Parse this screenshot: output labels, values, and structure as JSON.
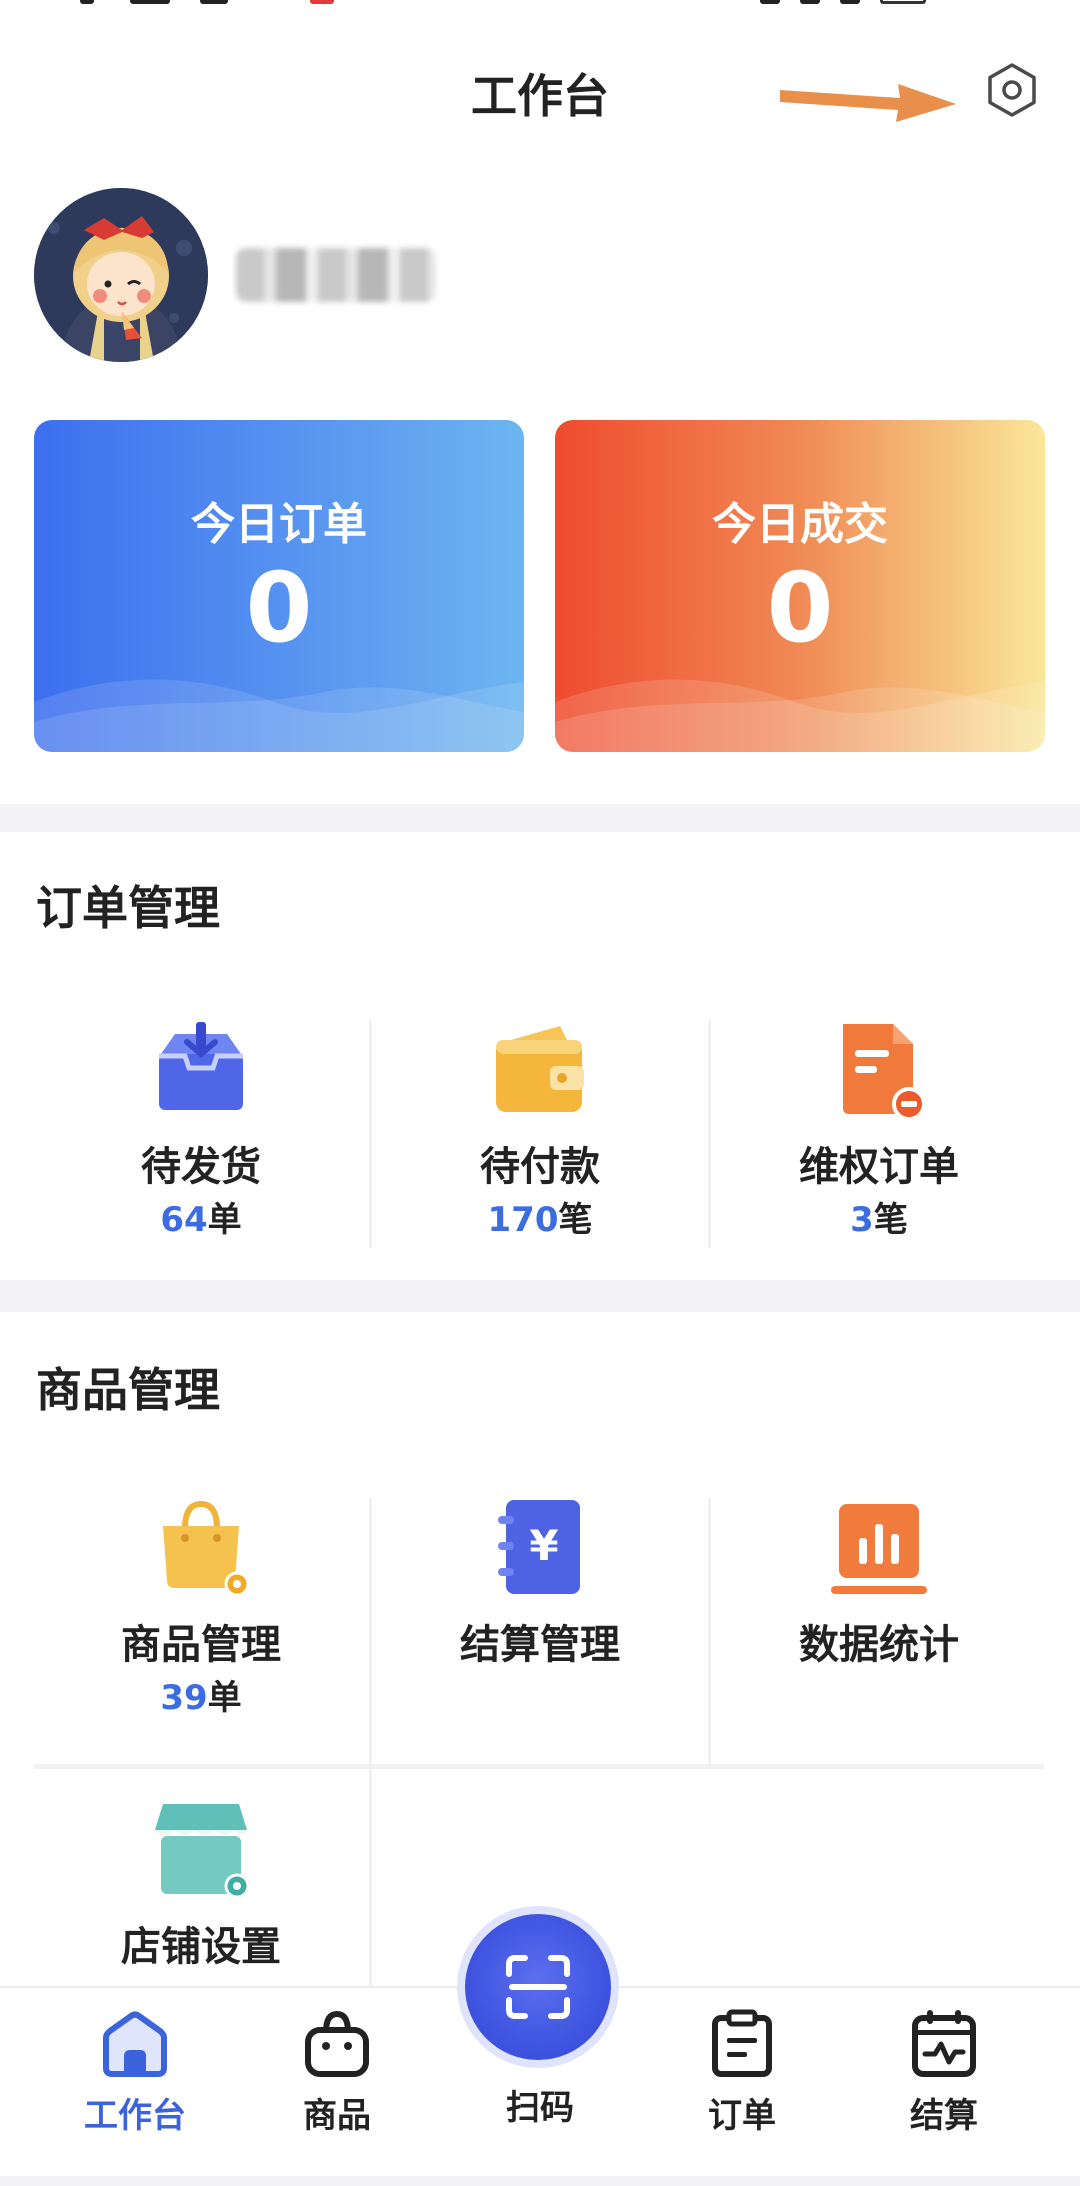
{
  "header": {
    "title": "工作台"
  },
  "profile": {
    "username": ""
  },
  "stats": [
    {
      "label": "今日订单",
      "value": "0"
    },
    {
      "label": "今日成交",
      "value": "0"
    }
  ],
  "orders": {
    "title": "订单管理",
    "items": [
      {
        "name": "待发货",
        "num": "64",
        "unit": "单",
        "icon": "inbox-icon"
      },
      {
        "name": "待付款",
        "num": "170",
        "unit": "笔",
        "icon": "wallet-icon"
      },
      {
        "name": "维权订单",
        "num": "3",
        "unit": "笔",
        "icon": "document-minus-icon"
      }
    ]
  },
  "goods": {
    "title": "商品管理",
    "items": [
      {
        "name": "商品管理",
        "num": "39",
        "unit": "单",
        "icon": "shopping-bag-gear-icon"
      },
      {
        "name": "结算管理",
        "icon": "yen-notebook-icon"
      },
      {
        "name": "数据统计",
        "icon": "bar-chart-icon"
      },
      {
        "name": "店铺设置",
        "icon": "store-gear-icon"
      }
    ]
  },
  "tabbar": [
    {
      "label": "工作台",
      "icon": "home-icon",
      "active": true
    },
    {
      "label": "商品",
      "icon": "bag-icon"
    },
    {
      "label": "扫码",
      "icon": "scan-icon"
    },
    {
      "label": "订单",
      "icon": "clipboard-icon"
    },
    {
      "label": "结算",
      "icon": "calendar-chart-icon"
    }
  ],
  "colors": {
    "accent": "#3a63dc",
    "count_number": "#3b6de0",
    "card_blue": "#3d6fef",
    "card_orange": "#ef4b2e",
    "annotation_arrow": "#e8904b"
  }
}
